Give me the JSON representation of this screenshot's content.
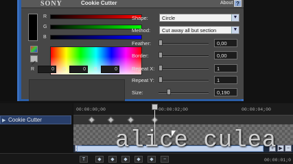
{
  "plugin": {
    "brand": "SONY",
    "title": "Cookie Cutter",
    "about": "About",
    "help": "?",
    "channels": [
      "R",
      "G",
      "B"
    ],
    "rgb_values": {
      "r": "0",
      "g": "0",
      "b": "0"
    },
    "rgb_labels": {
      "r": "R",
      "g": "G",
      "b": "B"
    },
    "bar_colors": {
      "r": "#ff0000",
      "g": "#00ff00",
      "b": "#0000ff"
    },
    "params": {
      "shape_label": "Shape:",
      "shape_value": "Circle",
      "method_label": "Method:",
      "method_value": "Cut away all but section",
      "feather_label": "Feather:",
      "feather_value": "0,00",
      "border_label": "Border:",
      "border_value": "0,00",
      "repeat_x_label": "Repeat X:",
      "repeat_x_value": "1",
      "repeat_y_label": "Repeat Y:",
      "repeat_y_value": "1",
      "size_label": "Size:",
      "size_value": "0,190"
    }
  },
  "timeline": {
    "track_name": "Cookie Cutter",
    "timecodes": [
      "00:00:00;00",
      "00:00:02;00",
      "00:00:04;00"
    ],
    "end_timecode": "00:00:01;0",
    "keyframe_count": 6
  },
  "watermark": "alice culea",
  "icons": {
    "swatch": "color-swatch",
    "palette": "palette-icon",
    "eyedropper": "eyedropper-icon",
    "track_arrow": "triangle-right-icon",
    "prev_keyframe": "prev-keyframe-icon",
    "next_keyframe": "next-keyframe-icon"
  }
}
